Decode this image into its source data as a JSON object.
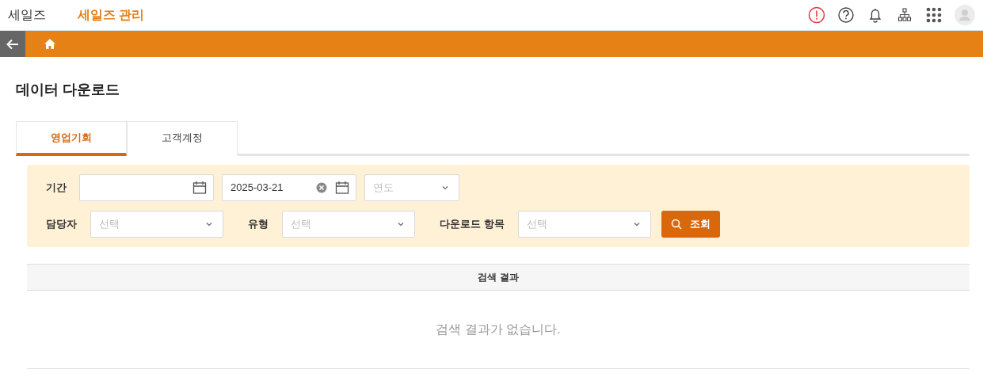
{
  "header": {
    "brand": "세일즈",
    "app_title": "세일즈 관리"
  },
  "page": {
    "title": "데이터 다운로드"
  },
  "tabs": [
    {
      "label": "영업기회",
      "selected": true
    },
    {
      "label": "고객계정",
      "selected": false
    }
  ],
  "filters": {
    "period_label": "기간",
    "end_date": {
      "value": "2025-03-21"
    },
    "year": {
      "placeholder": "연도"
    },
    "owner_label": "담당자",
    "owner": {
      "placeholder": "선택"
    },
    "type_label": "유형",
    "type": {
      "placeholder": "선택"
    },
    "items_label": "다운로드 항목",
    "items": {
      "placeholder": "선택"
    },
    "search_button": "조회"
  },
  "results": {
    "header": "검색 결과",
    "empty_message": "검색 결과가 없습니다."
  }
}
